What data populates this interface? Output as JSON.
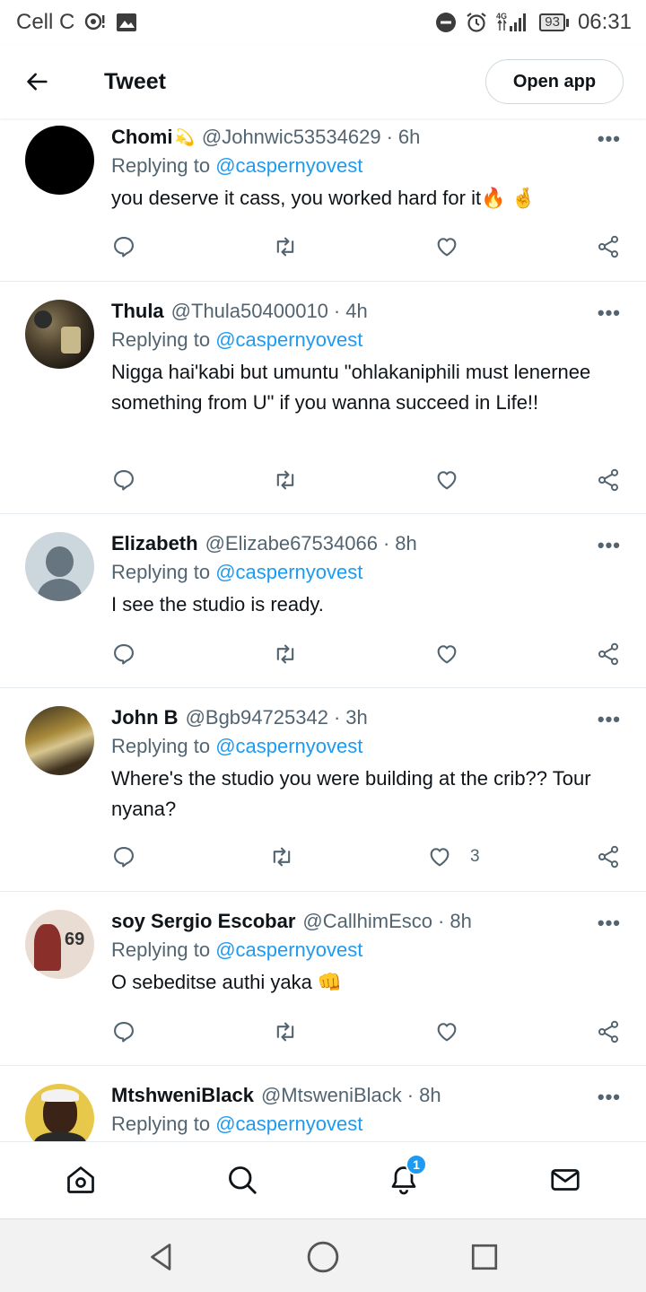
{
  "status_bar": {
    "carrier": "Cell C",
    "network": "4G",
    "battery": "93",
    "time": "06:31"
  },
  "header": {
    "title": "Tweet",
    "open_app_label": "Open app"
  },
  "tweets": [
    {
      "name": "Chomi",
      "emoji": "💫",
      "handle": "@Johnwic53534629",
      "time": "6h",
      "replying_prefix": "Replying to ",
      "replying_to": "@caspernyovest",
      "text": "you deserve it cass, you worked hard for it🔥 🤞",
      "likes": ""
    },
    {
      "name": "Thula",
      "emoji": "",
      "handle": "@Thula50400010",
      "time": "4h",
      "replying_prefix": "Replying to ",
      "replying_to": "@caspernyovest",
      "text": "Nigga hai'kabi but umuntu \"ohlakaniphili must lenernee something from U\" if you wanna succeed in Life!!",
      "likes": ""
    },
    {
      "name": "Elizabeth",
      "emoji": "",
      "handle": "@Elizabe67534066",
      "time": "8h",
      "replying_prefix": "Replying to ",
      "replying_to": "@caspernyovest",
      "text": "I see the studio is ready.",
      "likes": ""
    },
    {
      "name": "John B",
      "emoji": "",
      "handle": "@Bgb94725342",
      "time": "3h",
      "replying_prefix": "Replying to ",
      "replying_to": "@caspernyovest",
      "text": "Where's the studio you were building at the crib?? Tour nyana?",
      "likes": "3"
    },
    {
      "name": "soy Sergio Escobar",
      "emoji": "",
      "handle": "@CallhimEsco",
      "time": "8h",
      "replying_prefix": "Replying to ",
      "replying_to": "@caspernyovest",
      "text": "O sebeditse authi yaka 👊",
      "likes": ""
    },
    {
      "name": "MtshweniBlack",
      "emoji": "",
      "handle": "@MtsweniBlack",
      "time": "8h",
      "replying_prefix": "Replying to ",
      "replying_to": "@caspernyovest",
      "text": "",
      "likes": ""
    }
  ],
  "tabbar": {
    "notifications_badge": "1"
  },
  "icons": {
    "reply": "reply-icon",
    "retweet": "retweet-icon",
    "like": "like-icon",
    "share": "share-icon",
    "more": "more-icon"
  },
  "colors": {
    "accent": "#1d9bf0",
    "text": "#0f1419",
    "secondary": "#536471"
  }
}
